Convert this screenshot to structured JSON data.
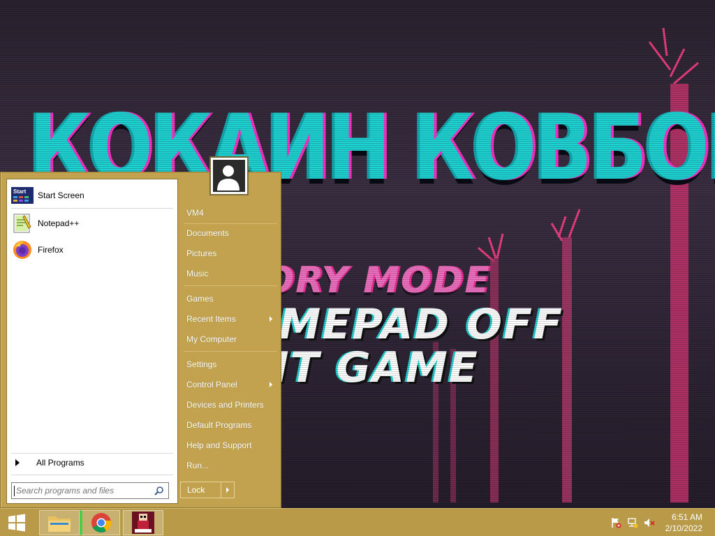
{
  "wallpaper": {
    "game_title": "КОКАИН КОВБОЙ",
    "menu_story": "STORY MODE",
    "menu_gamepad": "GAMEPAD OFF",
    "menu_exit": "EXIT GAME"
  },
  "start_menu": {
    "pinned": [
      {
        "label": "Start Screen",
        "icon": "start-screen-icon"
      },
      {
        "label": "Notepad++",
        "icon": "notepadpp-icon"
      },
      {
        "label": "Firefox",
        "icon": "firefox-icon"
      }
    ],
    "all_programs": "All Programs",
    "search_placeholder": "Search programs and files",
    "right_items": [
      {
        "label": "VM4"
      },
      {
        "label": "Documents"
      },
      {
        "label": "Pictures"
      },
      {
        "label": "Music"
      },
      {
        "label": "Games"
      },
      {
        "label": "Recent Items",
        "has_submenu": true
      },
      {
        "label": "My Computer"
      },
      {
        "label": "Settings"
      },
      {
        "label": "Control Panel",
        "has_submenu": true
      },
      {
        "label": "Devices and Printers"
      },
      {
        "label": "Default Programs"
      },
      {
        "label": "Help and Support"
      },
      {
        "label": "Run..."
      }
    ],
    "lock_label": "Lock"
  },
  "taskbar": {
    "apps": [
      {
        "name": "File Explorer",
        "icon": "folder-icon"
      },
      {
        "name": "Google Chrome",
        "icon": "chrome-icon"
      },
      {
        "name": "Game",
        "icon": "game-icon"
      }
    ],
    "clock_time": "6:51 AM",
    "clock_date": "2/10/2022"
  },
  "colors": {
    "menu_bg": "#c2a24e",
    "taskbar_bg": "#b89a48",
    "title_cyan": "#1fd0d0",
    "title_magenta": "#ff2fc8"
  }
}
